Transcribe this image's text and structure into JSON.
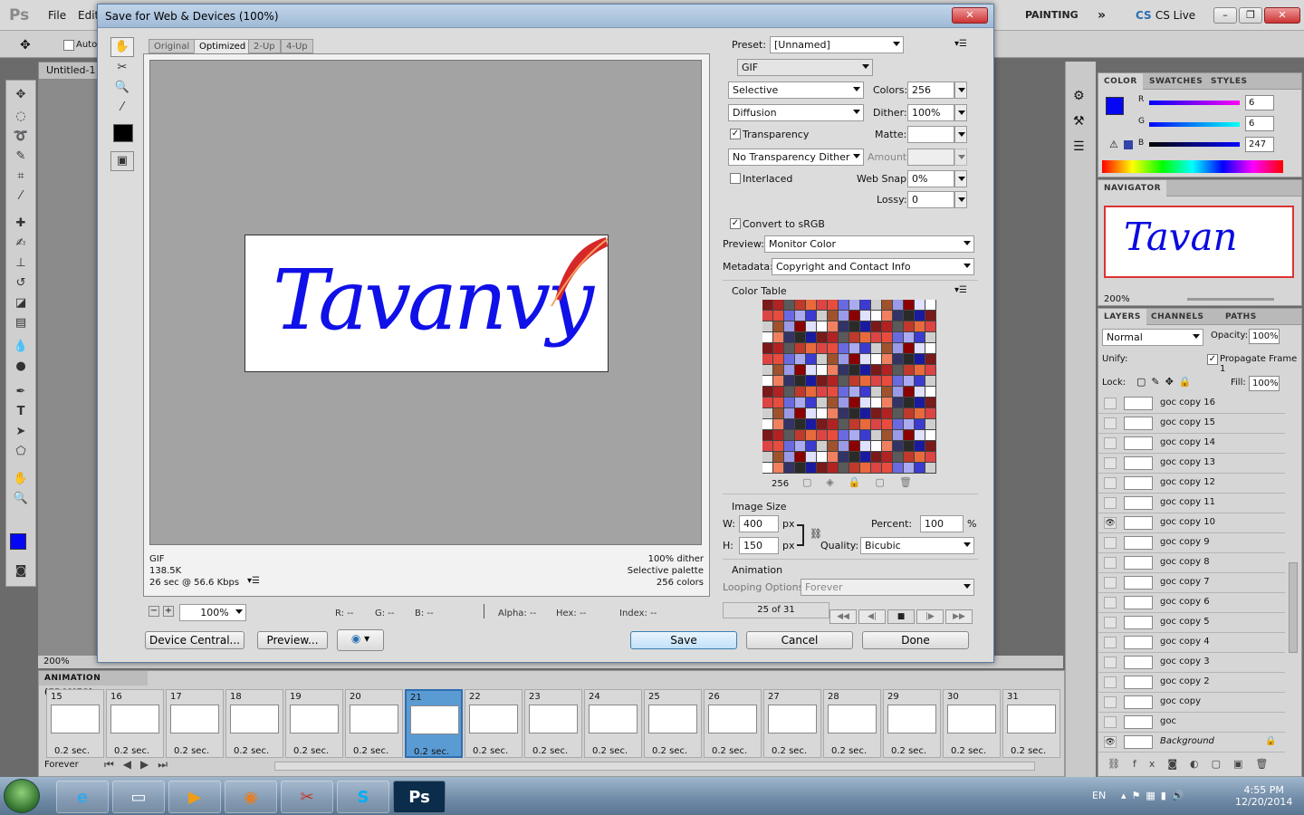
{
  "app": {
    "logo": "Ps",
    "menus": [
      "File",
      "Edit"
    ],
    "workspace_buttons": [
      "PAINTING",
      "»"
    ],
    "cs_live": "CS Live"
  },
  "options_bar": {
    "auto_select_label": "Auto"
  },
  "document": {
    "tab_title": "Untitled-1",
    "zoom": "200%"
  },
  "dialog": {
    "title": "Save for Web & Devices (100%)",
    "view_tabs": [
      "Original",
      "Optimized",
      "2-Up",
      "4-Up"
    ],
    "active_tab": "Optimized",
    "image_text": "Tavanvy",
    "info_left": {
      "format": "GIF",
      "size": "138.5K",
      "speed": "26 sec @ 56.6 Kbps"
    },
    "info_right": {
      "dither": "100% dither",
      "palette": "Selective palette",
      "colors": "256 colors"
    },
    "zoom_value": "100%",
    "readouts": {
      "r": "R: --",
      "g": "G: --",
      "b": "B: --",
      "alpha": "Alpha: --",
      "hex": "Hex: --",
      "index": "Index: --"
    },
    "buttons": {
      "device_central": "Device Central...",
      "preview": "Preview...",
      "save": "Save",
      "cancel": "Cancel",
      "done": "Done"
    },
    "settings": {
      "preset_label": "Preset:",
      "preset_value": "[Unnamed]",
      "format": "GIF",
      "reduction": "Selective",
      "colors_label": "Colors:",
      "colors_value": "256",
      "dither_algo": "Diffusion",
      "dither_label": "Dither:",
      "dither_value": "100%",
      "transparency_label": "Transparency",
      "matte_label": "Matte:",
      "trans_dither": "No Transparency Dither",
      "amount_label": "Amount:",
      "interlaced_label": "Interlaced",
      "websnap_label": "Web Snap:",
      "websnap_value": "0%",
      "lossy_label": "Lossy:",
      "lossy_value": "0",
      "srgb_label": "Convert to sRGB",
      "preview_label": "Preview:",
      "preview_value": "Monitor Color",
      "metadata_label": "Metadata:",
      "metadata_value": "Copyright and Contact Info",
      "color_table_label": "Color Table",
      "color_count": "256",
      "image_size_label": "Image Size",
      "w_label": "W:",
      "w_value": "400",
      "h_label": "H:",
      "h_value": "150",
      "px": "px",
      "percent_label": "Percent:",
      "percent_value": "100",
      "percent_unit": "%",
      "quality_label": "Quality:",
      "quality_value": "Bicubic",
      "animation_label": "Animation",
      "looping_label": "Looping Options:",
      "looping_value": "Forever",
      "frame_counter": "25 of 31"
    },
    "palette_colors": [
      "#7a1a1a",
      "#c0392b",
      "#e74c3c",
      "#3b3bcf",
      "#9a9ae8",
      "#ffffff",
      "#2a2a2a",
      "#b22222",
      "#e86a3c",
      "#6a6ae0",
      "#cfcfcf",
      "#8b0000",
      "#f08060",
      "#1a1aa0",
      "#5a5a5a",
      "#d44",
      "#aaaaf0",
      "#a0522d",
      "#e0e0ff",
      "#333366"
    ]
  },
  "color_panel": {
    "tabs": [
      "COLOR",
      "SWATCHES",
      "STYLES"
    ],
    "r_label": "R",
    "r_value": "6",
    "g_label": "G",
    "g_value": "6",
    "b_label": "B",
    "b_value": "247",
    "fg_color": "#0606f7"
  },
  "navigator": {
    "title": "NAVIGATOR",
    "zoom": "200%",
    "thumb_text": "Tavan"
  },
  "layers_panel": {
    "tabs": [
      "LAYERS",
      "CHANNELS",
      "PATHS"
    ],
    "blend_mode": "Normal",
    "opacity_label": "Opacity:",
    "opacity_value": "100%",
    "unify_label": "Unify:",
    "propagate_label": "Propagate Frame 1",
    "lock_label": "Lock:",
    "fill_label": "Fill:",
    "fill_value": "100%",
    "layers": [
      {
        "name": "goc copy 16",
        "visible": false
      },
      {
        "name": "goc copy 15",
        "visible": false
      },
      {
        "name": "goc copy 14",
        "visible": false
      },
      {
        "name": "goc copy 13",
        "visible": false
      },
      {
        "name": "goc copy 12",
        "visible": false
      },
      {
        "name": "goc copy 11",
        "visible": false
      },
      {
        "name": "goc copy 10",
        "visible": true
      },
      {
        "name": "goc copy 9",
        "visible": false
      },
      {
        "name": "goc copy 8",
        "visible": false
      },
      {
        "name": "goc copy 7",
        "visible": false
      },
      {
        "name": "goc copy 6",
        "visible": false
      },
      {
        "name": "goc copy 5",
        "visible": false
      },
      {
        "name": "goc copy 4",
        "visible": false
      },
      {
        "name": "goc copy 3",
        "visible": false
      },
      {
        "name": "goc copy 2",
        "visible": false
      },
      {
        "name": "goc copy",
        "visible": false
      },
      {
        "name": "goc",
        "visible": false
      },
      {
        "name": "Background",
        "visible": true
      }
    ]
  },
  "animation": {
    "title": "ANIMATION (FRAMES)",
    "loop": "Forever",
    "selected": "21",
    "frames": [
      {
        "num": "15",
        "delay": "0.2 sec."
      },
      {
        "num": "16",
        "delay": "0.2 sec."
      },
      {
        "num": "17",
        "delay": "0.2 sec."
      },
      {
        "num": "18",
        "delay": "0.2 sec."
      },
      {
        "num": "19",
        "delay": "0.2 sec."
      },
      {
        "num": "20",
        "delay": "0.2 sec."
      },
      {
        "num": "21",
        "delay": "0.2 sec."
      },
      {
        "num": "22",
        "delay": "0.2 sec."
      },
      {
        "num": "23",
        "delay": "0.2 sec."
      },
      {
        "num": "24",
        "delay": "0.2 sec."
      },
      {
        "num": "25",
        "delay": "0.2 sec."
      },
      {
        "num": "26",
        "delay": "0.2 sec."
      },
      {
        "num": "27",
        "delay": "0.2 sec."
      },
      {
        "num": "28",
        "delay": "0.2 sec."
      },
      {
        "num": "29",
        "delay": "0.2 sec."
      },
      {
        "num": "30",
        "delay": "0.2 sec."
      },
      {
        "num": "31",
        "delay": "0.2 sec."
      }
    ]
  },
  "taskbar": {
    "apps": [
      "ie-icon",
      "explorer-icon",
      "media-icon",
      "firefox-icon",
      "ccleaner-icon",
      "skype-icon",
      "photoshop-icon"
    ],
    "ps_label": "Ps",
    "lang": "EN",
    "time": "4:55 PM",
    "date": "12/20/2014"
  }
}
